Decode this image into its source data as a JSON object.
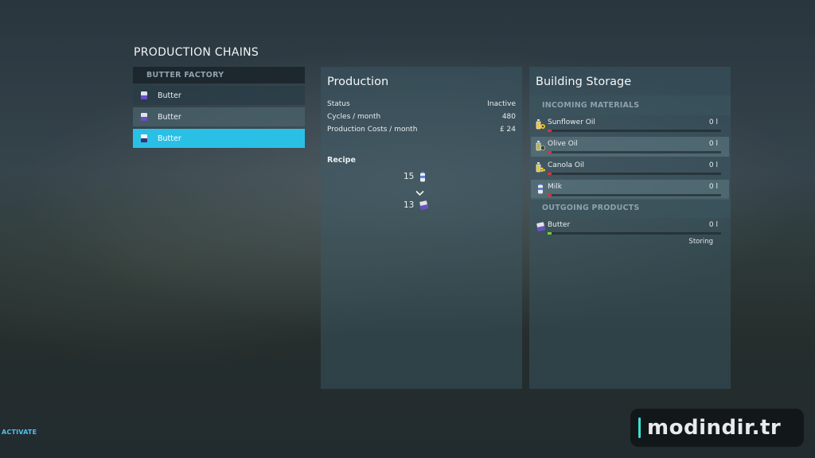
{
  "page_title": "PRODUCTION CHAINS",
  "chains": {
    "header": "BUTTER FACTORY",
    "items": [
      {
        "label": "Butter",
        "icon": "butter-icon"
      },
      {
        "label": "Butter",
        "icon": "butter-icon"
      },
      {
        "label": "Butter",
        "icon": "butter-icon",
        "selected": true
      }
    ]
  },
  "production": {
    "title": "Production",
    "status_label": "Status",
    "status_value": "Inactive",
    "cycles_label": "Cycles / month",
    "cycles_value": "480",
    "costs_label": "Production Costs / month",
    "costs_value": "£ 24",
    "recipe_label": "Recipe",
    "recipe_input_qty": "15",
    "recipe_input_icon": "milk-bottle-icon",
    "recipe_output_qty": "13",
    "recipe_output_icon": "butter-icon"
  },
  "storage": {
    "title": "Building Storage",
    "incoming_label": "INCOMING MATERIALS",
    "incoming": [
      {
        "name": "Sunflower Oil",
        "amount": "0 l",
        "icon": "sunflower-oil-icon",
        "fill_color": "#d8323c"
      },
      {
        "name": "Olive Oil",
        "amount": "0 l",
        "icon": "olive-oil-icon",
        "fill_color": "#d8323c"
      },
      {
        "name": "Canola Oil",
        "amount": "0 l",
        "icon": "canola-oil-icon",
        "fill_color": "#d8323c"
      },
      {
        "name": "Milk",
        "amount": "0 l",
        "icon": "milk-bottle-icon",
        "fill_color": "#d8323c"
      }
    ],
    "outgoing_label": "OUTGOING PRODUCTS",
    "outgoing": [
      {
        "name": "Butter",
        "amount": "0 l",
        "state": "Storing",
        "icon": "butter-icon",
        "fill_color": "#6fd23a"
      }
    ]
  },
  "footer": {
    "activate_label": "ACTIVATE"
  },
  "watermark": {
    "text": "modindir.tr"
  },
  "colors": {
    "accent": "#2ac0e6",
    "danger": "#d8323c",
    "ok": "#6fd23a"
  }
}
